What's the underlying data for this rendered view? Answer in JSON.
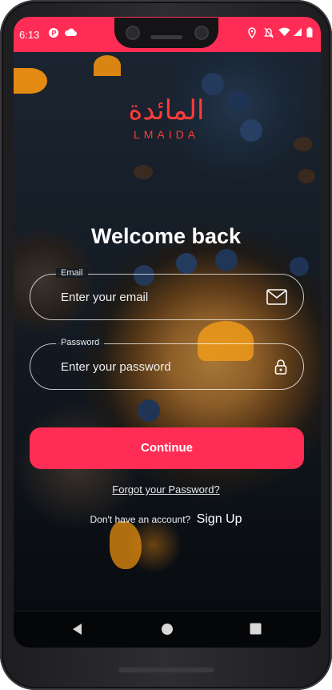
{
  "status_bar": {
    "time": "6:13"
  },
  "logo": {
    "arabic": "المائدة",
    "latin": "LMAIDA"
  },
  "title": "Welcome back",
  "email": {
    "label": "Email",
    "placeholder": "Enter your email"
  },
  "password": {
    "label": "Password",
    "placeholder": "Enter your password"
  },
  "continue_label": "Continue",
  "forgot_label": "Forgot your Password?",
  "signup": {
    "prompt": "Don't have an account?",
    "link": "Sign Up"
  },
  "icons": [
    "mail-icon",
    "lock-icon",
    "back-icon",
    "home-icon",
    "recents-icon",
    "wifi-icon",
    "battery-icon",
    "location-icon",
    "mute-icon",
    "signal-icon",
    "cloud-icon",
    "app-icon"
  ],
  "colors": {
    "accent": "#ff2d55",
    "logo": "#ff3b3b"
  }
}
